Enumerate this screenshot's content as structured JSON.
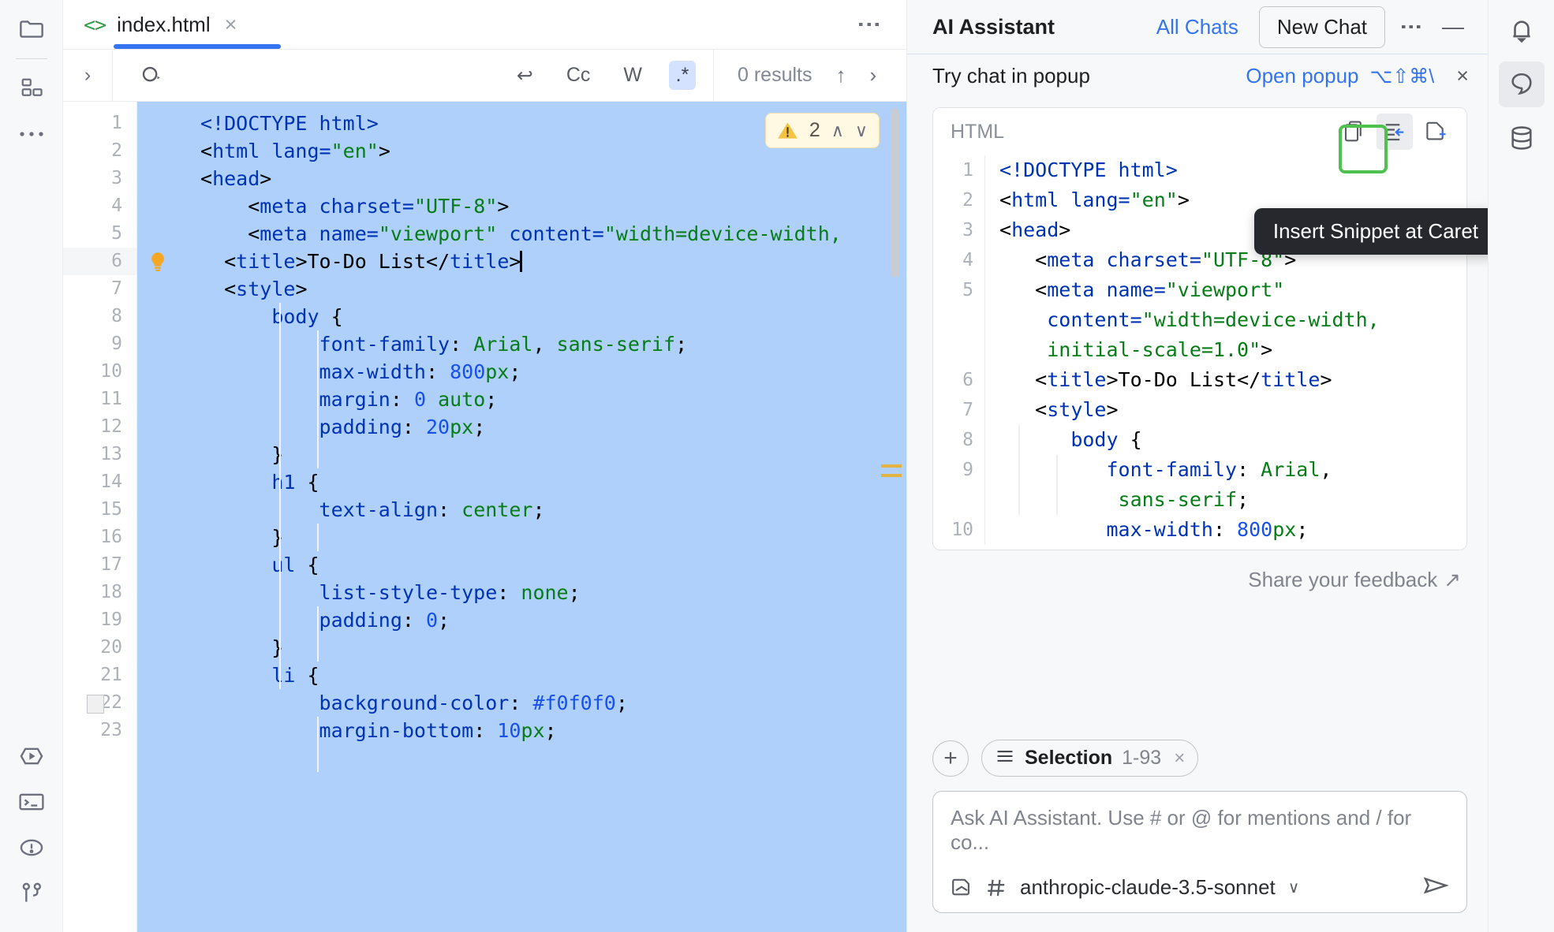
{
  "toolwindow_left": {
    "items": [
      {
        "name": "project-files",
        "icon": "folder-icon"
      },
      {
        "name": "structure",
        "icon": "structure-icon"
      },
      {
        "name": "more-tool-windows",
        "icon": "more-icon"
      },
      {
        "name": "run",
        "icon": "run-icon"
      },
      {
        "name": "terminal",
        "icon": "terminal-icon"
      },
      {
        "name": "problems",
        "icon": "problems-icon"
      },
      {
        "name": "version-control",
        "icon": "branch-icon"
      }
    ]
  },
  "editor": {
    "tab": {
      "filename": "index.html",
      "lang_icon": "<>",
      "close_label": "×"
    },
    "kebab_label": "⋮",
    "search": {
      "expand_label": "›",
      "search_icon": "search-icon",
      "options": [
        {
          "id": "preserve-case",
          "label": "↩",
          "active": false
        },
        {
          "id": "match-case",
          "label": "Cc",
          "active": false
        },
        {
          "id": "words",
          "label": "W",
          "active": false
        },
        {
          "id": "regex",
          "label": ".*",
          "active": true
        }
      ],
      "results_text": "0 results",
      "prev_label": "↑",
      "next_label": "›"
    },
    "inspection_widget": {
      "icon": "warning-icon",
      "count": "2",
      "up_label": "∧",
      "down_label": "∨"
    },
    "current_line": 6,
    "lines": [
      {
        "n": 1,
        "tokens": [
          {
            "t": "tag",
            "v": "<!DOCTYPE "
          },
          {
            "t": "tag2",
            "v": "html"
          },
          {
            "t": "tag",
            "v": ">"
          }
        ]
      },
      {
        "n": 2,
        "tokens": [
          {
            "t": "punc",
            "v": "<"
          },
          {
            "t": "tag",
            "v": "html "
          },
          {
            "t": "tag",
            "v": "lang="
          },
          {
            "t": "str",
            "v": "\"en\""
          },
          {
            "t": "punc",
            "v": ">"
          }
        ]
      },
      {
        "n": 3,
        "tokens": [
          {
            "t": "punc",
            "v": "<"
          },
          {
            "t": "tag",
            "v": "head"
          },
          {
            "t": "punc",
            "v": ">"
          }
        ]
      },
      {
        "n": 4,
        "tokens": [
          {
            "t": "txt",
            "v": "    "
          },
          {
            "t": "punc",
            "v": "<"
          },
          {
            "t": "tag",
            "v": "meta "
          },
          {
            "t": "tag",
            "v": "charset="
          },
          {
            "t": "str",
            "v": "\"UTF-8\""
          },
          {
            "t": "punc",
            "v": ">"
          }
        ]
      },
      {
        "n": 5,
        "tokens": [
          {
            "t": "txt",
            "v": "    "
          },
          {
            "t": "punc",
            "v": "<"
          },
          {
            "t": "tag",
            "v": "meta "
          },
          {
            "t": "tag",
            "v": "name="
          },
          {
            "t": "str",
            "v": "\"viewport\""
          },
          {
            "t": "txt",
            "v": " "
          },
          {
            "t": "tag",
            "v": "content="
          },
          {
            "t": "str",
            "v": "\"width=device-width,"
          }
        ]
      },
      {
        "n": 6,
        "bulb": true,
        "tokens": [
          {
            "t": "txt",
            "v": "  "
          },
          {
            "t": "punc",
            "v": "<"
          },
          {
            "t": "tag",
            "v": "title"
          },
          {
            "t": "punc",
            "v": ">"
          },
          {
            "t": "txt",
            "v": "To-Do List"
          },
          {
            "t": "punc",
            "v": "</"
          },
          {
            "t": "tag",
            "v": "title"
          },
          {
            "t": "punc",
            "v": ">"
          }
        ],
        "caret": true
      },
      {
        "n": 7,
        "tokens": [
          {
            "t": "txt",
            "v": "  "
          },
          {
            "t": "punc",
            "v": "<"
          },
          {
            "t": "tag",
            "v": "style"
          },
          {
            "t": "punc",
            "v": ">"
          }
        ]
      },
      {
        "n": 8,
        "tokens": [
          {
            "t": "txt",
            "v": "      "
          },
          {
            "t": "sel",
            "v": "body"
          },
          {
            "t": "txt",
            "v": " {"
          }
        ]
      },
      {
        "n": 9,
        "tokens": [
          {
            "t": "txt",
            "v": "          "
          },
          {
            "t": "prop",
            "v": "font-family"
          },
          {
            "t": "txt",
            "v": ": "
          },
          {
            "t": "val",
            "v": "Arial"
          },
          {
            "t": "txt",
            "v": ", "
          },
          {
            "t": "val",
            "v": "sans-serif"
          },
          {
            "t": "txt",
            "v": ";"
          }
        ]
      },
      {
        "n": 10,
        "tokens": [
          {
            "t": "txt",
            "v": "          "
          },
          {
            "t": "prop",
            "v": "max-width"
          },
          {
            "t": "txt",
            "v": ": "
          },
          {
            "t": "num",
            "v": "800"
          },
          {
            "t": "val",
            "v": "px"
          },
          {
            "t": "txt",
            "v": ";"
          }
        ]
      },
      {
        "n": 11,
        "tokens": [
          {
            "t": "txt",
            "v": "          "
          },
          {
            "t": "prop",
            "v": "margin"
          },
          {
            "t": "txt",
            "v": ": "
          },
          {
            "t": "num",
            "v": "0"
          },
          {
            "t": "txt",
            "v": " "
          },
          {
            "t": "val",
            "v": "auto"
          },
          {
            "t": "txt",
            "v": ";"
          }
        ]
      },
      {
        "n": 12,
        "tokens": [
          {
            "t": "txt",
            "v": "          "
          },
          {
            "t": "prop",
            "v": "padding"
          },
          {
            "t": "txt",
            "v": ": "
          },
          {
            "t": "num",
            "v": "20"
          },
          {
            "t": "val",
            "v": "px"
          },
          {
            "t": "txt",
            "v": ";"
          }
        ]
      },
      {
        "n": 13,
        "tokens": [
          {
            "t": "txt",
            "v": "      }"
          }
        ]
      },
      {
        "n": 14,
        "tokens": [
          {
            "t": "txt",
            "v": "      "
          },
          {
            "t": "sel",
            "v": "h1"
          },
          {
            "t": "txt",
            "v": " {"
          }
        ]
      },
      {
        "n": 15,
        "tokens": [
          {
            "t": "txt",
            "v": "          "
          },
          {
            "t": "prop",
            "v": "text-align"
          },
          {
            "t": "txt",
            "v": ": "
          },
          {
            "t": "val",
            "v": "center"
          },
          {
            "t": "txt",
            "v": ";"
          }
        ]
      },
      {
        "n": 16,
        "tokens": [
          {
            "t": "txt",
            "v": "      }"
          }
        ]
      },
      {
        "n": 17,
        "tokens": [
          {
            "t": "txt",
            "v": "      "
          },
          {
            "t": "sel",
            "v": "ul"
          },
          {
            "t": "txt",
            "v": " {"
          }
        ]
      },
      {
        "n": 18,
        "tokens": [
          {
            "t": "txt",
            "v": "          "
          },
          {
            "t": "prop",
            "v": "list-style-type"
          },
          {
            "t": "txt",
            "v": ": "
          },
          {
            "t": "val",
            "v": "none"
          },
          {
            "t": "txt",
            "v": ";"
          }
        ]
      },
      {
        "n": 19,
        "tokens": [
          {
            "t": "txt",
            "v": "          "
          },
          {
            "t": "prop",
            "v": "padding"
          },
          {
            "t": "txt",
            "v": ": "
          },
          {
            "t": "num",
            "v": "0"
          },
          {
            "t": "txt",
            "v": ";"
          }
        ]
      },
      {
        "n": 20,
        "tokens": [
          {
            "t": "txt",
            "v": "      }"
          }
        ]
      },
      {
        "n": 21,
        "tokens": [
          {
            "t": "txt",
            "v": "      "
          },
          {
            "t": "sel",
            "v": "li"
          },
          {
            "t": "txt",
            "v": " {"
          }
        ]
      },
      {
        "n": 22,
        "swatch": "#f0f0f0",
        "tokens": [
          {
            "t": "txt",
            "v": "          "
          },
          {
            "t": "prop",
            "v": "background-color"
          },
          {
            "t": "txt",
            "v": ": "
          },
          {
            "t": "num",
            "v": "#f0f0f0"
          },
          {
            "t": "txt",
            "v": ";"
          }
        ]
      },
      {
        "n": 23,
        "tokens": [
          {
            "t": "txt",
            "v": "          "
          },
          {
            "t": "prop",
            "v": "margin-bottom"
          },
          {
            "t": "txt",
            "v": ": "
          },
          {
            "t": "num",
            "v": "10"
          },
          {
            "t": "val",
            "v": "px"
          },
          {
            "t": "txt",
            "v": ";"
          }
        ]
      }
    ]
  },
  "ai_assistant": {
    "title": "AI Assistant",
    "all_chats_label": "All Chats",
    "new_chat_label": "New Chat",
    "kebab_label": "⋮",
    "minimize_label": "—",
    "banner": {
      "text": "Try chat in popup",
      "link": "Open popup",
      "shortcut": "⌥⇧⌘\\",
      "close_label": "×"
    },
    "snippet": {
      "language": "HTML",
      "actions": [
        {
          "id": "copy-snippet",
          "icon": "copy-icon",
          "selected": false
        },
        {
          "id": "insert-snippet-at-caret",
          "icon": "insert-at-caret-icon",
          "selected": true
        },
        {
          "id": "new-file-from-snippet",
          "icon": "new-file-icon",
          "selected": false
        }
      ],
      "tooltip": "Insert Snippet at Caret",
      "lines": [
        {
          "n": "1",
          "tokens": [
            {
              "t": "tag",
              "v": "<!DOCTYPE "
            },
            {
              "t": "tag2",
              "v": "html"
            },
            {
              "t": "tag",
              "v": ">"
            }
          ]
        },
        {
          "n": "2",
          "tokens": [
            {
              "t": "punc",
              "v": "<"
            },
            {
              "t": "tag",
              "v": "html "
            },
            {
              "t": "tag",
              "v": "lang="
            },
            {
              "t": "str",
              "v": "\"en\""
            },
            {
              "t": "punc",
              "v": ">"
            }
          ]
        },
        {
          "n": "3",
          "tokens": [
            {
              "t": "punc",
              "v": "<"
            },
            {
              "t": "tag",
              "v": "head"
            },
            {
              "t": "punc",
              "v": ">"
            }
          ]
        },
        {
          "n": "4",
          "tokens": [
            {
              "t": "txt",
              "v": "   "
            },
            {
              "t": "punc",
              "v": "<"
            },
            {
              "t": "tag",
              "v": "meta "
            },
            {
              "t": "tag",
              "v": "charset="
            },
            {
              "t": "str",
              "v": "\"UTF-8\""
            },
            {
              "t": "punc",
              "v": ">"
            }
          ]
        },
        {
          "n": "5",
          "tokens": [
            {
              "t": "txt",
              "v": "   "
            },
            {
              "t": "punc",
              "v": "<"
            },
            {
              "t": "tag",
              "v": "meta "
            },
            {
              "t": "tag",
              "v": "name="
            },
            {
              "t": "str",
              "v": "\"viewport\""
            }
          ]
        },
        {
          "n": "",
          "tokens": [
            {
              "t": "txt",
              "v": "    "
            },
            {
              "t": "tag",
              "v": "content="
            },
            {
              "t": "str",
              "v": "\"width=device-width,"
            }
          ]
        },
        {
          "n": "",
          "tokens": [
            {
              "t": "txt",
              "v": "    "
            },
            {
              "t": "str",
              "v": "initial-scale=1.0\""
            },
            {
              "t": "punc",
              "v": ">"
            }
          ]
        },
        {
          "n": "6",
          "tokens": [
            {
              "t": "txt",
              "v": "   "
            },
            {
              "t": "punc",
              "v": "<"
            },
            {
              "t": "tag",
              "v": "title"
            },
            {
              "t": "punc",
              "v": ">"
            },
            {
              "t": "txt",
              "v": "To-Do List"
            },
            {
              "t": "punc",
              "v": "</"
            },
            {
              "t": "tag",
              "v": "title"
            },
            {
              "t": "punc",
              "v": ">"
            }
          ]
        },
        {
          "n": "7",
          "tokens": [
            {
              "t": "txt",
              "v": "   "
            },
            {
              "t": "punc",
              "v": "<"
            },
            {
              "t": "tag",
              "v": "style"
            },
            {
              "t": "punc",
              "v": ">"
            }
          ]
        },
        {
          "n": "8",
          "tokens": [
            {
              "t": "txt",
              "v": "      "
            },
            {
              "t": "sel",
              "v": "body"
            },
            {
              "t": "txt",
              "v": " {"
            }
          ]
        },
        {
          "n": "9",
          "tokens": [
            {
              "t": "txt",
              "v": "         "
            },
            {
              "t": "prop",
              "v": "font-family"
            },
            {
              "t": "txt",
              "v": ": "
            },
            {
              "t": "val",
              "v": "Arial"
            },
            {
              "t": "txt",
              "v": ","
            }
          ]
        },
        {
          "n": "",
          "tokens": [
            {
              "t": "txt",
              "v": "          "
            },
            {
              "t": "val",
              "v": "sans-serif"
            },
            {
              "t": "txt",
              "v": ";"
            }
          ]
        },
        {
          "n": "10",
          "tokens": [
            {
              "t": "txt",
              "v": "         "
            },
            {
              "t": "prop",
              "v": "max-width"
            },
            {
              "t": "txt",
              "v": ": "
            },
            {
              "t": "num",
              "v": "800"
            },
            {
              "t": "val",
              "v": "px"
            },
            {
              "t": "txt",
              "v": ";"
            }
          ]
        }
      ]
    },
    "feedback_label": "Share your feedback",
    "feedback_arrow": "↗",
    "attachments": {
      "add_label": "+",
      "chip": {
        "icon": "lines-icon",
        "label": "Selection",
        "range": "1-93",
        "close_label": "×"
      }
    },
    "input": {
      "placeholder": "Ask AI Assistant. Use # or @ for mentions and / for co...",
      "value": "",
      "attach_icon": "attach-icon",
      "mention_icon": "#",
      "model": "anthropic-claude-3.5-sonnet",
      "model_caret": "∨",
      "send_icon": "send-icon"
    }
  },
  "toolwindow_right": {
    "items": [
      {
        "name": "notifications",
        "icon": "bell-icon",
        "boxed": false
      },
      {
        "name": "ai-assistant",
        "icon": "ai-icon",
        "boxed": true
      },
      {
        "name": "database",
        "icon": "database-icon",
        "boxed": false
      }
    ]
  },
  "colors": {
    "accent": "#3574f0",
    "selection": "#aed0fb",
    "tag": "#0033b3",
    "string": "#067d17",
    "number": "#1750eb",
    "highlight_ring": "#4ec14e"
  }
}
